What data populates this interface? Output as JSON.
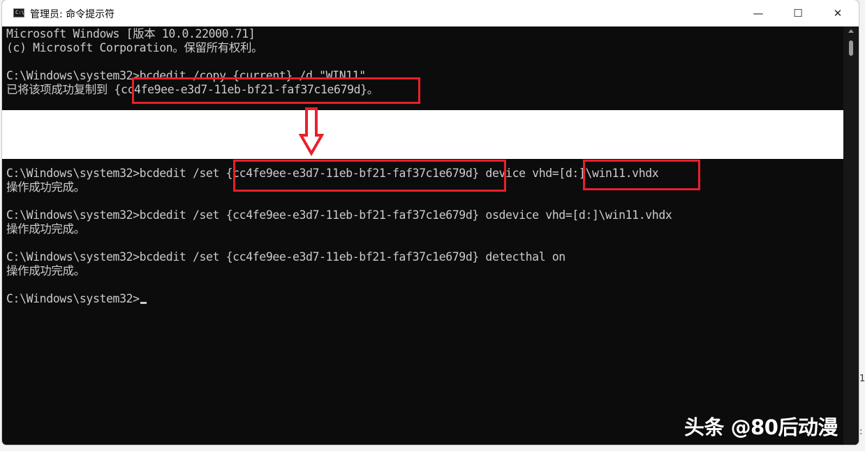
{
  "window": {
    "icon_text": "C:\\",
    "title": "管理员: 命令提示符",
    "controls": {
      "minimize": "—",
      "maximize": "☐",
      "close": "✕"
    }
  },
  "console": {
    "lines": [
      "Microsoft Windows [版本 10.0.22000.71]",
      "(c) Microsoft Corporation。保留所有权利。",
      "C:\\Windows\\system32>bcdedit /copy {current} /d \"WIN11\"",
      "已将该项成功复制到 {cc4fe9ee-e3d7-11eb-bf21-faf37c1e679d}。",
      "C:\\Windows\\system32>bcdedit /set {cc4fe9ee-e3d7-11eb-bf21-faf37c1e679d} device vhd=[d:]\\win11.vhdx",
      "操作成功完成。",
      "C:\\Windows\\system32>bcdedit /set {cc4fe9ee-e3d7-11eb-bf21-faf37c1e679d} osdevice vhd=[d:]\\win11.vhdx",
      "操作成功完成。",
      "C:\\Windows\\system32>bcdedit /set {cc4fe9ee-e3d7-11eb-bf21-faf37c1e679d} detecthal on",
      "操作成功完成。",
      "C:\\Windows\\system32>"
    ]
  },
  "annotation_colors": {
    "highlight": "#e8202b",
    "arrow": "#e8202b"
  },
  "watermark": "头条 @80后动漫",
  "edge_fragments": [
    "1",
    ":"
  ]
}
